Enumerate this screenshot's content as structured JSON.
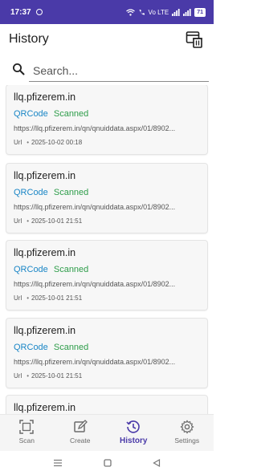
{
  "status_bar": {
    "time": "17:37",
    "network": "Vo LTE",
    "battery": "71"
  },
  "header": {
    "title": "History",
    "action_icon": "delete-history-icon"
  },
  "search": {
    "placeholder": "Search...",
    "value": ""
  },
  "history": [
    {
      "title": "llq.pfizerem.in",
      "type": "QRCode",
      "status": "Scanned",
      "url": "https://llq.pfizerem.in/qn/qnuiddata.aspx/01/8902...",
      "kind": "Url",
      "date": "2025-10-02 00:18"
    },
    {
      "title": "llq.pfizerem.in",
      "type": "QRCode",
      "status": "Scanned",
      "url": "https://llq.pfizerem.in/qn/qnuiddata.aspx/01/8902...",
      "kind": "Url",
      "date": "2025-10-01 21:51"
    },
    {
      "title": "llq.pfizerem.in",
      "type": "QRCode",
      "status": "Scanned",
      "url": "https://llq.pfizerem.in/qn/qnuiddata.aspx/01/8902...",
      "kind": "Url",
      "date": "2025-10-01 21:51"
    },
    {
      "title": "llq.pfizerem.in",
      "type": "QRCode",
      "status": "Scanned",
      "url": "https://llq.pfizerem.in/qn/qnuiddata.aspx/01/8902...",
      "kind": "Url",
      "date": "2025-10-01 21:51"
    },
    {
      "title": "llq.pfizerem.in",
      "type": "",
      "status": "",
      "url": "",
      "kind": "",
      "date": ""
    }
  ],
  "nav": {
    "items": [
      {
        "label": "Scan",
        "icon": "scan-icon"
      },
      {
        "label": "Create",
        "icon": "create-icon"
      },
      {
        "label": "History",
        "icon": "history-icon"
      },
      {
        "label": "Settings",
        "icon": "settings-icon"
      }
    ],
    "active_index": 2
  },
  "colors": {
    "accent": "#4a3aa8",
    "type_tag": "#1a86c6",
    "status_tag": "#2e9d4a"
  }
}
